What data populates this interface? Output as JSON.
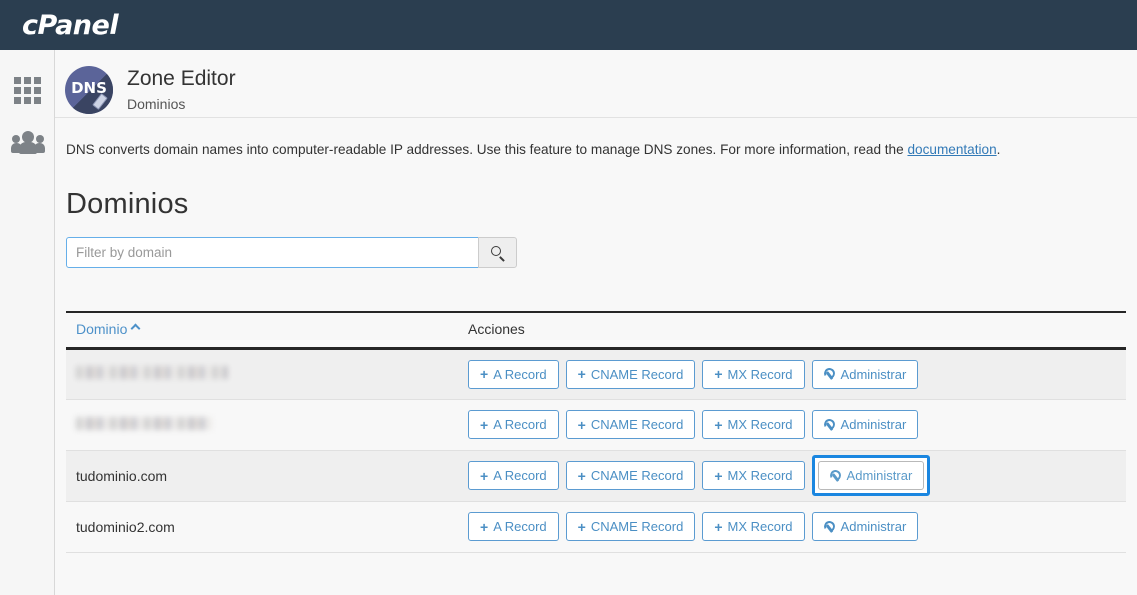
{
  "brand": {
    "name": "cPanel"
  },
  "sidebar": {
    "items": [
      {
        "name": "apps-grid-icon",
        "label": ""
      },
      {
        "name": "users-group-icon",
        "label": ""
      }
    ]
  },
  "header": {
    "badge_text": "DNS",
    "title": "Zone Editor",
    "subtitle": "Dominios"
  },
  "description": {
    "text_before_link": "DNS converts domain names into computer-readable IP addresses. Use this feature to manage DNS zones. For more information, read the ",
    "link_label": "documentation",
    "text_after_link": "."
  },
  "section": {
    "title": "Dominios"
  },
  "filter": {
    "placeholder": "Filter by domain",
    "value": "",
    "search_icon": "search-icon"
  },
  "table": {
    "columns": [
      {
        "label": "Dominio",
        "sorted": "asc",
        "sort_icon": "chevron-up-icon"
      },
      {
        "label": "Acciones"
      }
    ],
    "action_labels": {
      "a_record": "A Record",
      "cname_record": "CNAME Record",
      "mx_record": "MX Record",
      "manage": "Administrar",
      "plus_icon": "plus-icon",
      "wrench_icon": "wrench-icon"
    },
    "rows": [
      {
        "domain": "",
        "redacted": true,
        "focused_action": ""
      },
      {
        "domain": "",
        "redacted": true,
        "focused_action": ""
      },
      {
        "domain": "tudominio.com",
        "redacted": false,
        "focused_action": "manage"
      },
      {
        "domain": "tudominio2.com",
        "redacted": false,
        "focused_action": ""
      }
    ]
  },
  "colors": {
    "topbar": "#2b3e50",
    "accent_link": "#337ab7",
    "button_border": "#5b9bd1",
    "button_text": "#4b8fc4",
    "focus_ring": "#1a86e0",
    "badge": "#5b6499",
    "row_odd": "#efefef",
    "row_even": "#f8f8f8"
  }
}
